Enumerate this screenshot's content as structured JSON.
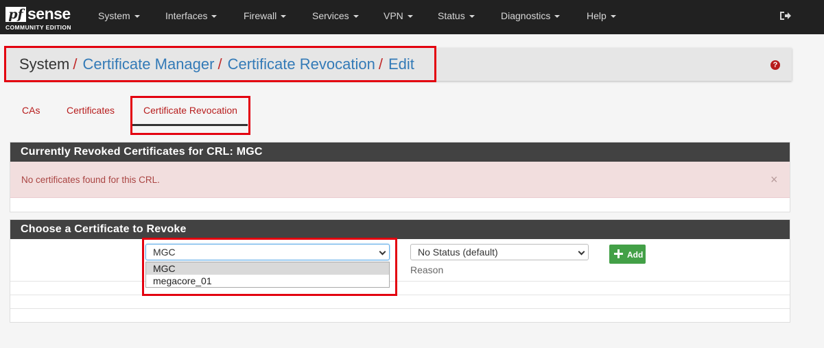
{
  "brand": {
    "name_prefix": "pf",
    "name_rest": "sense",
    "edition": "COMMUNITY EDITION"
  },
  "nav": {
    "items": [
      {
        "label": "System"
      },
      {
        "label": "Interfaces"
      },
      {
        "label": "Firewall"
      },
      {
        "label": "Services"
      },
      {
        "label": "VPN"
      },
      {
        "label": "Status"
      },
      {
        "label": "Diagnostics"
      },
      {
        "label": "Help"
      }
    ],
    "logout_icon": "sign-out-icon"
  },
  "breadcrumb": {
    "items": [
      "System",
      "Certificate Manager",
      "Certificate Revocation",
      "Edit"
    ],
    "separator": "/",
    "help_icon": "question-circle-icon"
  },
  "tabs": {
    "items": [
      {
        "label": "CAs"
      },
      {
        "label": "Certificates"
      },
      {
        "label": "Certificate Revocation",
        "active": true
      }
    ]
  },
  "revoked_panel": {
    "title": "Currently Revoked Certificates for CRL: MGC",
    "alert_text": "No certificates found for this CRL.",
    "close_glyph": "×"
  },
  "revoke_panel": {
    "title": "Choose a Certificate to Revoke",
    "certificate_select": {
      "value": "MGC",
      "options": [
        "MGC",
        "megacore_01"
      ],
      "open": true
    },
    "reason_select": {
      "value": "No Status (default)"
    },
    "reason_label": "Reason",
    "add_button": {
      "label": "Add",
      "icon": "plus-icon"
    }
  },
  "colors": {
    "navbar": "#212121",
    "link": "#337ab7",
    "tab_text": "#b71c1c",
    "panel_heading": "#424242",
    "alert_bg": "#f2dede",
    "add_button": "#43a047",
    "highlight": "#e3000f"
  }
}
